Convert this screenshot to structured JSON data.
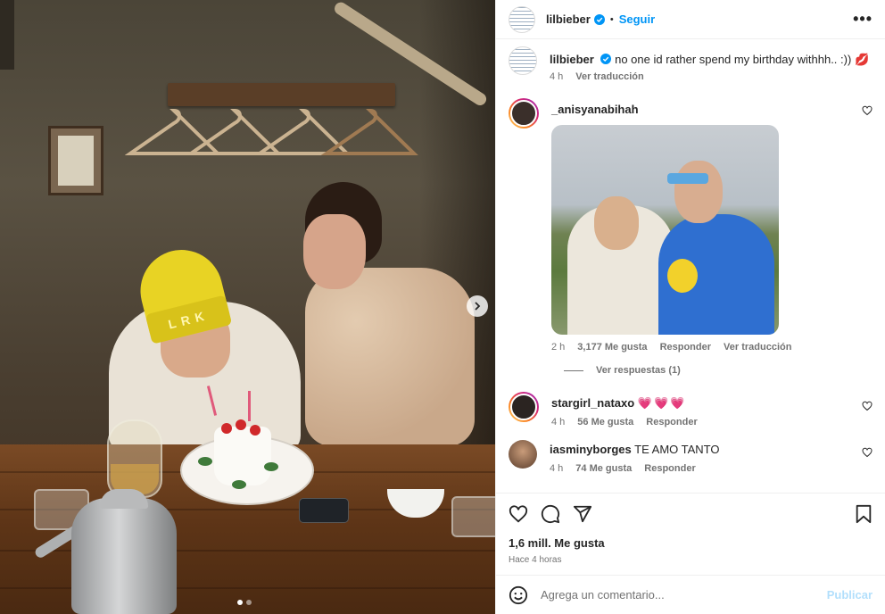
{
  "post": {
    "username": "lilbieber",
    "follow_label": "Seguir",
    "bullet": "•",
    "more_label": "•••"
  },
  "caption": {
    "username": "lilbieber",
    "text": "no one id rather spend my birthday withhh.. :))",
    "emoji": "💋",
    "time": "4 h",
    "translate_label": "Ver traducción"
  },
  "comments": [
    {
      "username": "_anisyanabihah",
      "time": "2 h",
      "likes": "3,177 Me gusta",
      "reply_label": "Responder",
      "translate_label": "Ver traducción",
      "view_replies": "Ver respuestas (1)"
    },
    {
      "username": "stargirl_nataxo",
      "text": "💗💗💗",
      "time": "4 h",
      "likes": "56 Me gusta",
      "reply_label": "Responder"
    },
    {
      "username": "iasminyborges",
      "text": "TE AMO TANTO",
      "time": "4 h",
      "likes": "74 Me gusta",
      "reply_label": "Responder"
    }
  ],
  "actions": {
    "likes": "1,6 mill. Me gusta",
    "time": "Hace 4 horas"
  },
  "add_comment": {
    "placeholder": "Agrega un comentario...",
    "post_label": "Publicar"
  },
  "photo": {
    "beanie_text": "LRK"
  },
  "colors": {
    "link_blue": "#0095f6",
    "publish_disabled": "#b2dffc",
    "heart_red": "#ed4956"
  },
  "icons": [
    "verified-icon",
    "more-icon",
    "heart-icon",
    "comment-icon",
    "share-icon",
    "bookmark-icon",
    "emoji-icon",
    "chevron-right-icon"
  ]
}
